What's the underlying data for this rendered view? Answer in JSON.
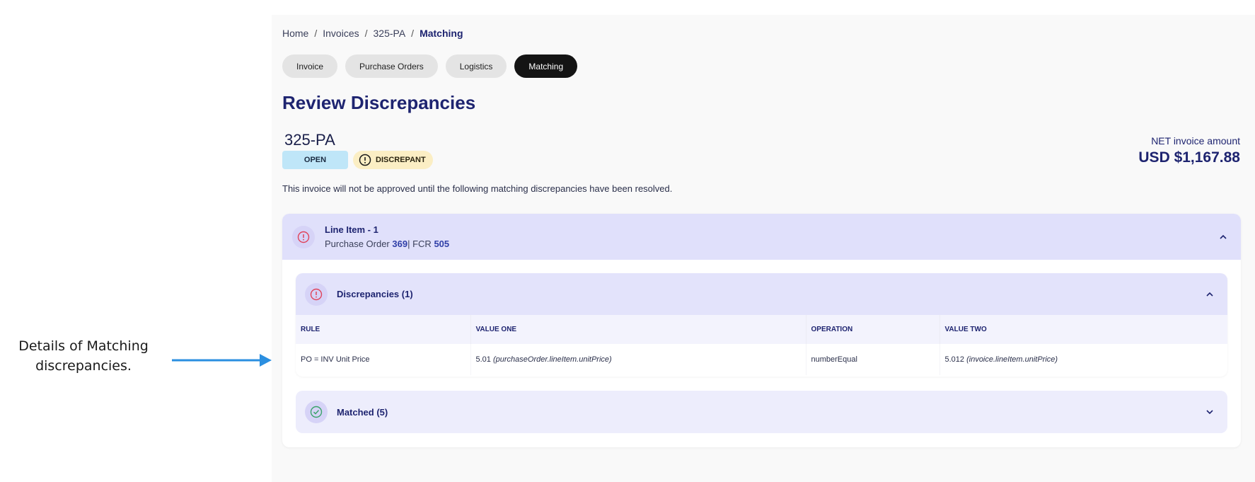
{
  "annotation": {
    "text": "Details of Matching discrepancies."
  },
  "breadcrumb": [
    "Home",
    "Invoices",
    "325-PA",
    "Matching"
  ],
  "tabs": [
    {
      "label": "Invoice"
    },
    {
      "label": "Purchase Orders"
    },
    {
      "label": "Logistics"
    },
    {
      "label": "Matching",
      "active": true
    }
  ],
  "page": {
    "title": "Review Discrepancies"
  },
  "invoice": {
    "id": "325-PA",
    "status_open": "OPEN",
    "status_discrepant": "DISCREPANT",
    "net_label": "NET invoice amount",
    "net_amount": "USD $1,167.88",
    "note": "This invoice will not be approved until the following matching discrepancies have been resolved."
  },
  "line_item": {
    "title": "Line Item - 1",
    "po_label": "Purchase Order",
    "po_number": "369",
    "fcr_label": "| FCR",
    "fcr_number": "505"
  },
  "discrepancies": {
    "title": "Discrepancies (1)",
    "columns": [
      "RULE",
      "VALUE ONE",
      "OPERATION",
      "VALUE TWO"
    ],
    "rows": [
      {
        "rule": "PO = INV Unit Price",
        "value_one": "5.01",
        "value_one_path": "(purchaseOrder.lineItem.unitPrice)",
        "operation": "numberEqual",
        "value_two": "5.012",
        "value_two_path": "(invoice.lineItem.unitPrice)"
      }
    ]
  },
  "matched": {
    "title": "Matched (5)"
  },
  "colors": {
    "accent": "#1e2470",
    "head_bg": "#e0e0fb",
    "open_badge": "#bfe6f8",
    "discrepant_badge": "#fbeec4",
    "error_icon": "#e0435a",
    "success_icon": "#3aa36a",
    "arrow": "#2b8fe0"
  }
}
